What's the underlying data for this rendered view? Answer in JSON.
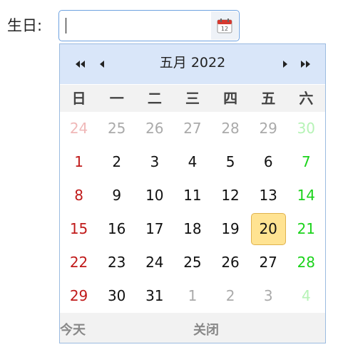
{
  "form": {
    "label": "生日:",
    "input_value": ""
  },
  "calendar": {
    "title": "五月 2022",
    "weekdays": [
      "日",
      "一",
      "二",
      "三",
      "四",
      "五",
      "六"
    ],
    "weeks": [
      [
        "24",
        "25",
        "26",
        "27",
        "28",
        "29",
        "30"
      ],
      [
        "1",
        "2",
        "3",
        "4",
        "5",
        "6",
        "7"
      ],
      [
        "8",
        "9",
        "10",
        "11",
        "12",
        "13",
        "14"
      ],
      [
        "15",
        "16",
        "17",
        "18",
        "19",
        "20",
        "21"
      ],
      [
        "22",
        "23",
        "24",
        "25",
        "26",
        "27",
        "28"
      ],
      [
        "29",
        "30",
        "31",
        "1",
        "2",
        "3",
        "4"
      ]
    ],
    "selected": "20",
    "today_label": "今天",
    "close_label": "关闭"
  },
  "colors": {
    "header_bg": "#d9e6f9",
    "selected_bg": "#ffe392",
    "sunday": "#c01a1a",
    "saturday": "#1bd31b",
    "other_month": "#aaaaaa"
  },
  "icons": {
    "calendar_button": "calendar-icon",
    "prev_year": "double-chevron-left-icon",
    "prev_month": "chevron-left-icon",
    "next_month": "chevron-right-icon",
    "next_year": "double-chevron-right-icon"
  }
}
